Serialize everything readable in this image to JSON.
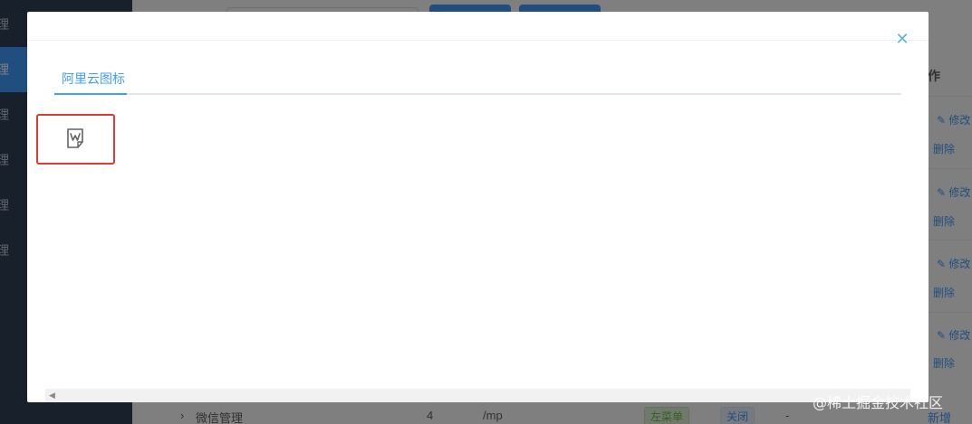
{
  "sidebar": {
    "items": [
      {
        "label": "理",
        "active": false
      },
      {
        "label": "理",
        "active": true
      },
      {
        "label": "理",
        "active": false
      },
      {
        "label": "理",
        "active": false
      },
      {
        "label": "理",
        "active": false
      },
      {
        "label": "理",
        "active": false
      }
    ]
  },
  "table": {
    "op_header": "作",
    "rows": [
      {
        "edit": "修改",
        "delete": "删除"
      },
      {
        "edit": "修改",
        "delete": "删除"
      },
      {
        "edit": "修改",
        "delete": "删除"
      },
      {
        "edit": "修改",
        "delete": "删除"
      }
    ],
    "bottom_row": {
      "name": "微信管理",
      "order": "4",
      "path": "/mp",
      "type": "左菜单",
      "status": "关闭",
      "perm": "-",
      "op_partial": "新增"
    }
  },
  "dialog": {
    "tab_label": "阿里云图标",
    "close_icon": "close-icon",
    "selected_icon": "word-document-icon"
  },
  "watermark": "@稀土掘金技术社区",
  "colors": {
    "accent": "#409eff",
    "highlight_border": "#e03a32",
    "sidebar_bg": "#304156"
  }
}
